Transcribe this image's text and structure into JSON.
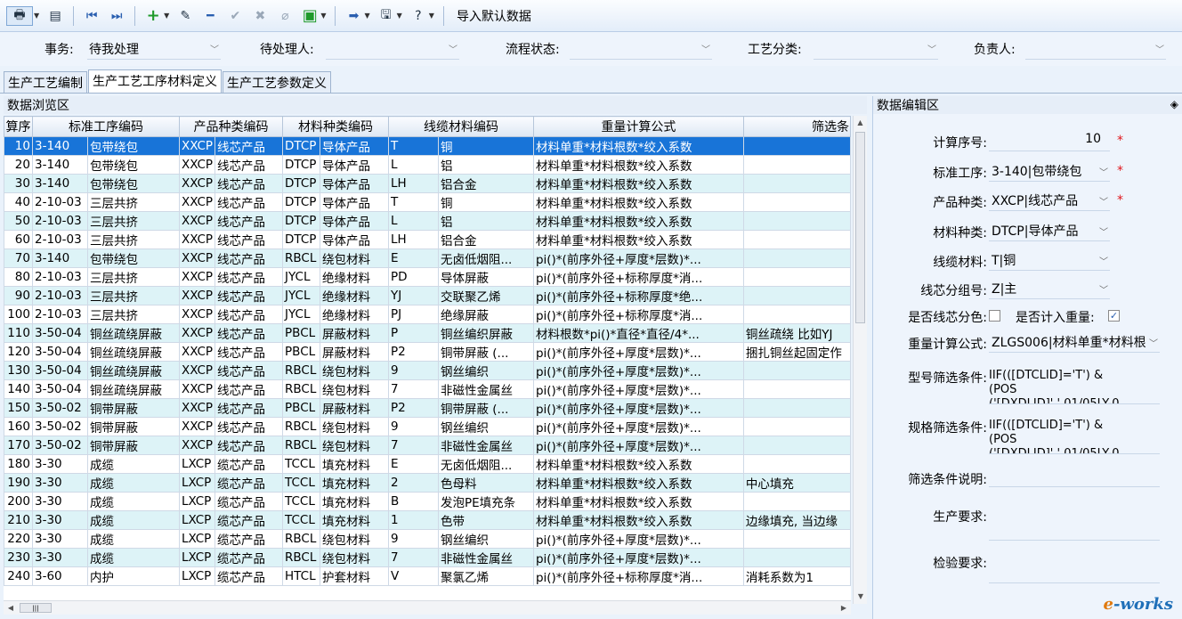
{
  "toolbar": {
    "title": "导入默认数据",
    "icons": [
      "print-icon",
      "table-icon",
      "first-icon",
      "last-icon",
      "add-icon",
      "edit-icon",
      "minus-icon",
      "check-icon",
      "delete-icon",
      "attach-icon",
      "export-icon",
      "arrow-right-icon",
      "save-icon",
      "help-icon"
    ]
  },
  "filters": {
    "matter_label": "事务:",
    "matter_value": "待我处理",
    "pending_label": "待处理人:",
    "status_label": "流程状态:",
    "category_label": "工艺分类:",
    "owner_label": "负责人:"
  },
  "tabs": [
    "生产工艺编制",
    "生产工艺工序材料定义",
    "生产工艺参数定义"
  ],
  "browse": {
    "title": "数据浏览区",
    "columns": [
      "算序",
      "标准工序编码",
      "产品种类编码",
      "材料种类编码",
      "线缆材料编码",
      "重量计算公式",
      "筛选条"
    ],
    "rows": [
      [
        "10",
        "3-140",
        "包带绕包",
        "XXCP",
        "线芯产品",
        "DTCP",
        "导体产品",
        "T",
        "铜",
        "材料单重*材料根数*绞入系数",
        ""
      ],
      [
        "20",
        "3-140",
        "包带绕包",
        "XXCP",
        "线芯产品",
        "DTCP",
        "导体产品",
        "L",
        "铝",
        "材料单重*材料根数*绞入系数",
        ""
      ],
      [
        "30",
        "3-140",
        "包带绕包",
        "XXCP",
        "线芯产品",
        "DTCP",
        "导体产品",
        "LH",
        "铝合金",
        "材料单重*材料根数*绞入系数",
        ""
      ],
      [
        "40",
        "2-10-03",
        "三层共挤",
        "XXCP",
        "线芯产品",
        "DTCP",
        "导体产品",
        "T",
        "铜",
        "材料单重*材料根数*绞入系数",
        ""
      ],
      [
        "50",
        "2-10-03",
        "三层共挤",
        "XXCP",
        "线芯产品",
        "DTCP",
        "导体产品",
        "L",
        "铝",
        "材料单重*材料根数*绞入系数",
        ""
      ],
      [
        "60",
        "2-10-03",
        "三层共挤",
        "XXCP",
        "线芯产品",
        "DTCP",
        "导体产品",
        "LH",
        "铝合金",
        "材料单重*材料根数*绞入系数",
        ""
      ],
      [
        "70",
        "3-140",
        "包带绕包",
        "XXCP",
        "线芯产品",
        "RBCL",
        "绕包材料",
        "E",
        "无卤低烟阻...",
        "pi()*(前序外径+厚度*层数)*...",
        ""
      ],
      [
        "80",
        "2-10-03",
        "三层共挤",
        "XXCP",
        "线芯产品",
        "JYCL",
        "绝缘材料",
        "PD",
        "导体屏蔽",
        "pi()*(前序外径+标称厚度*消...",
        ""
      ],
      [
        "90",
        "2-10-03",
        "三层共挤",
        "XXCP",
        "线芯产品",
        "JYCL",
        "绝缘材料",
        "YJ",
        "交联聚乙烯",
        "pi()*(前序外径+标称厚度*绝...",
        ""
      ],
      [
        "100",
        "2-10-03",
        "三层共挤",
        "XXCP",
        "线芯产品",
        "JYCL",
        "绝缘材料",
        "PJ",
        "绝缘屏蔽",
        "pi()*(前序外径+标称厚度*消...",
        ""
      ],
      [
        "110",
        "3-50-04",
        "铜丝疏绕屏蔽",
        "XXCP",
        "线芯产品",
        "PBCL",
        "屏蔽材料",
        "P",
        "铜丝编织屏蔽",
        "材料根数*pi()*直径*直径/4*...",
        "铜丝疏绕 比如YJ"
      ],
      [
        "120",
        "3-50-04",
        "铜丝疏绕屏蔽",
        "XXCP",
        "线芯产品",
        "PBCL",
        "屏蔽材料",
        "P2",
        "铜带屏蔽 (...",
        "pi()*(前序外径+厚度*层数)*...",
        "捆扎铜丝起固定作"
      ],
      [
        "130",
        "3-50-04",
        "铜丝疏绕屏蔽",
        "XXCP",
        "线芯产品",
        "RBCL",
        "绕包材料",
        "9",
        "钢丝编织",
        "pi()*(前序外径+厚度*层数)*...",
        ""
      ],
      [
        "140",
        "3-50-04",
        "铜丝疏绕屏蔽",
        "XXCP",
        "线芯产品",
        "RBCL",
        "绕包材料",
        "7",
        "非磁性金属丝",
        "pi()*(前序外径+厚度*层数)*...",
        ""
      ],
      [
        "150",
        "3-50-02",
        "铜带屏蔽",
        "XXCP",
        "线芯产品",
        "PBCL",
        "屏蔽材料",
        "P2",
        "铜带屏蔽 (...",
        "pi()*(前序外径+厚度*层数)*...",
        ""
      ],
      [
        "160",
        "3-50-02",
        "铜带屏蔽",
        "XXCP",
        "线芯产品",
        "RBCL",
        "绕包材料",
        "9",
        "钢丝编织",
        "pi()*(前序外径+厚度*层数)*...",
        ""
      ],
      [
        "170",
        "3-50-02",
        "铜带屏蔽",
        "XXCP",
        "线芯产品",
        "RBCL",
        "绕包材料",
        "7",
        "非磁性金属丝",
        "pi()*(前序外径+厚度*层数)*...",
        ""
      ],
      [
        "180",
        "3-30",
        "成缆",
        "LXCP",
        "缆芯产品",
        "TCCL",
        "填充材料",
        "E",
        "无卤低烟阻...",
        "材料单重*材料根数*绞入系数",
        ""
      ],
      [
        "190",
        "3-30",
        "成缆",
        "LXCP",
        "缆芯产品",
        "TCCL",
        "填充材料",
        "2",
        "色母料",
        "材料单重*材料根数*绞入系数",
        "中心填充"
      ],
      [
        "200",
        "3-30",
        "成缆",
        "LXCP",
        "缆芯产品",
        "TCCL",
        "填充材料",
        "B",
        "发泡PE填充条",
        "材料单重*材料根数*绞入系数",
        ""
      ],
      [
        "210",
        "3-30",
        "成缆",
        "LXCP",
        "缆芯产品",
        "TCCL",
        "填充材料",
        "1",
        "色带",
        "材料单重*材料根数*绞入系数",
        "边缘填充, 当边缘"
      ],
      [
        "220",
        "3-30",
        "成缆",
        "LXCP",
        "缆芯产品",
        "RBCL",
        "绕包材料",
        "9",
        "钢丝编织",
        "pi()*(前序外径+厚度*层数)*...",
        ""
      ],
      [
        "230",
        "3-30",
        "成缆",
        "LXCP",
        "缆芯产品",
        "RBCL",
        "绕包材料",
        "7",
        "非磁性金属丝",
        "pi()*(前序外径+厚度*层数)*...",
        ""
      ],
      [
        "240",
        "3-60",
        "内护",
        "LXCP",
        "缆芯产品",
        "HTCL",
        "护套材料",
        "V",
        "聚氯乙烯",
        "pi()*(前序外径+标称厚度*消...",
        "消耗系数为1"
      ]
    ]
  },
  "edit": {
    "title": "数据编辑区",
    "calc_seq_label": "计算序号:",
    "calc_seq_value": "10",
    "std_proc_label": "标准工序:",
    "std_proc_value": "3-140|包带绕包",
    "product_label": "产品种类:",
    "product_value": "XXCP|线芯产品",
    "material_kind_label": "材料种类:",
    "material_kind_value": "DTCP|导体产品",
    "cable_mat_label": "线缆材料:",
    "cable_mat_value": "T|铜",
    "core_group_label": "线芯分组号:",
    "core_group_value": "Z|主",
    "color_label": "是否线芯分色:",
    "weight_flag_label": "是否计入重量:",
    "formula_label": "重量计算公式:",
    "formula_value": "ZLGS006|材料单重*材料根",
    "model_filter_label": "型号筛选条件:",
    "model_filter_value": "IIF(([DTCLID]='T') &\n(POS\n('[DXDLID]',',01/05LY-0",
    "spec_filter_label": "规格筛选条件:",
    "spec_filter_value": "IIF(([DTCLID]='T') &\n(POS\n('[DXDLID]',',01/05LY-0",
    "filter_desc_label": "筛选条件说明:",
    "prod_req_label": "生产要求:",
    "inspect_req_label": "检验要求:",
    "required_mark": "*"
  },
  "logo": {
    "e": "e",
    "rest": "-works"
  }
}
